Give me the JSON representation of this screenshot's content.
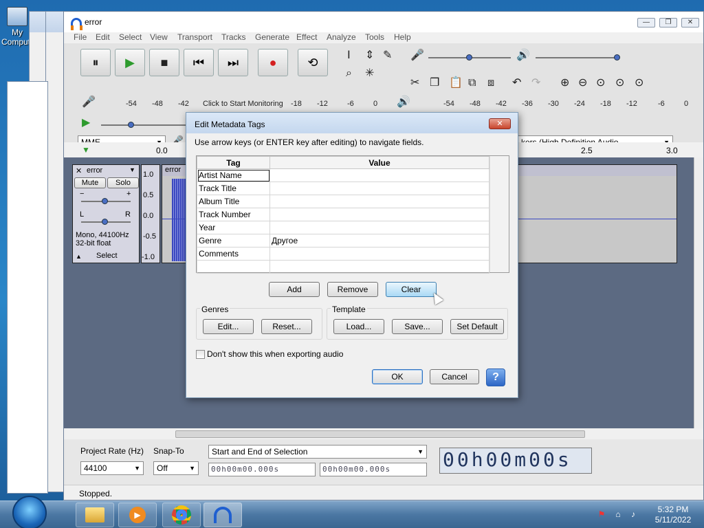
{
  "desktop": {
    "icon_label": "My Computer"
  },
  "window": {
    "title": "error",
    "minimize": "—",
    "maximize": "❐",
    "close": "✕"
  },
  "menu": [
    "File",
    "Edit",
    "Select",
    "View",
    "Transport",
    "Tracks",
    "Generate",
    "Effect",
    "Analyze",
    "Tools",
    "Help"
  ],
  "toolbar": {
    "pause": "⏸",
    "play": "▶",
    "stop": "■",
    "skip_start": "⏮",
    "skip_end": "⏭",
    "record": "●",
    "loop": "⟲",
    "record_meter_ticks": [
      "-54",
      "-48",
      "-42",
      "Click to Start Monitoring",
      "-18",
      "-12",
      "-6",
      "0"
    ],
    "play_meter_ticks": [
      "-54",
      "-48",
      "-42",
      "-36",
      "-30",
      "-24",
      "-18",
      "-12",
      "-6",
      "0"
    ],
    "lr": "L\nR",
    "host": "MME",
    "output_device": "kers (High Definition Audio"
  },
  "ruler": {
    "ticks": [
      "0.0",
      "2.5",
      "3.0"
    ]
  },
  "track": {
    "name": "error",
    "mute": "Mute",
    "solo": "Solo",
    "gain_minus": "−",
    "gain_plus": "+",
    "pan_l": "L",
    "pan_r": "R",
    "info1": "Mono, 44100Hz",
    "info2": "32-bit float",
    "select": "Select",
    "scale": [
      "1.0",
      "0.5",
      "0.0",
      "-0.5",
      "-1.0"
    ],
    "clip_name": "error"
  },
  "status": {
    "project_rate_label": "Project Rate (Hz)",
    "snap_label": "Snap-To",
    "project_rate": "44100",
    "snap": "Off",
    "selection_mode": "Start and End of Selection",
    "sel_start": "00h00m00.000s",
    "sel_end": "00h00m00.000s",
    "big_time": "00h00m00s",
    "state": "Stopped."
  },
  "dialog": {
    "title": "Edit Metadata Tags",
    "close": "✕",
    "hint": "Use arrow keys (or ENTER key after editing) to navigate fields.",
    "col_tag": "Tag",
    "col_value": "Value",
    "rows": [
      {
        "tag": "Artist Name",
        "value": ""
      },
      {
        "tag": "Track Title",
        "value": ""
      },
      {
        "tag": "Album Title",
        "value": ""
      },
      {
        "tag": "Track Number",
        "value": ""
      },
      {
        "tag": "Year",
        "value": ""
      },
      {
        "tag": "Genre",
        "value": "Другое"
      },
      {
        "tag": "Comments",
        "value": ""
      },
      {
        "tag": "",
        "value": ""
      }
    ],
    "add": "Add",
    "remove": "Remove",
    "clear": "Clear",
    "genres_label": "Genres",
    "genres_edit": "Edit...",
    "genres_reset": "Reset...",
    "template_label": "Template",
    "template_load": "Load...",
    "template_save": "Save...",
    "template_default": "Set Default",
    "dont_show": "Don't show this when exporting audio",
    "ok": "OK",
    "cancel": "Cancel",
    "help": "?"
  },
  "taskbar": {
    "time": "5:32 PM",
    "date": "5/11/2022"
  }
}
